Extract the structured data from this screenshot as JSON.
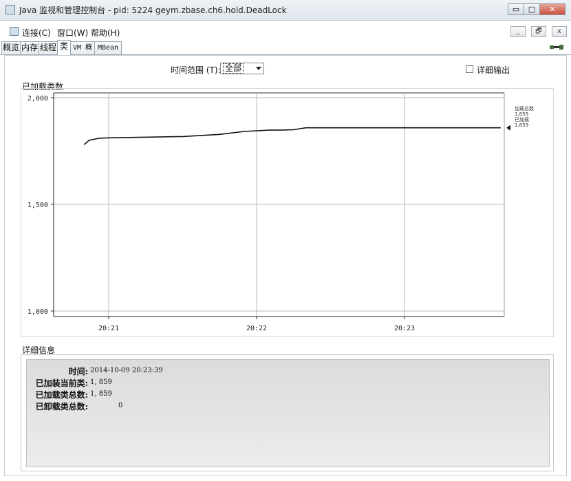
{
  "window": {
    "title": "Java 监视和管理控制台 - pid: 5224 geym.zbase.ch6.hold.DeadLock",
    "controls": {
      "minimize": "▭",
      "maximize": "□",
      "close": "✕"
    }
  },
  "menu": {
    "items": [
      "连接(C)",
      "窗口(W)",
      "帮助(H)"
    ],
    "inner_controls": [
      "_",
      "🗗",
      "x"
    ]
  },
  "tabs": [
    {
      "label": "概览",
      "active": false
    },
    {
      "label": "内存",
      "active": false
    },
    {
      "label": "线程",
      "active": false
    },
    {
      "label": "类",
      "active": true
    },
    {
      "label": "VM 概要",
      "active": false
    },
    {
      "label": "MBean",
      "active": false
    }
  ],
  "toolbar": {
    "range_label": "时间范围 (T):",
    "range_value": "全部",
    "detail_output_label": "详细输出"
  },
  "chart_section_label": "已加载类数",
  "chart_data": {
    "type": "line",
    "title": "已加载类数",
    "y_ticks": [
      "2,000",
      "1,500",
      "1,000"
    ],
    "x_ticks": [
      "20:21",
      "20:22",
      "20:23"
    ],
    "ylim": [
      1000,
      2000
    ],
    "grid": true,
    "legend": {
      "entries": [
        "加载总数",
        "1,859",
        "已加载",
        "1,859"
      ],
      "placement": "right"
    },
    "series": [
      {
        "name": "已加载",
        "x": [
          "20:20:50",
          "20:20:52",
          "20:20:56",
          "20:21:00",
          "20:21:10",
          "20:21:30",
          "20:21:45",
          "20:21:55",
          "20:22:05",
          "20:22:10",
          "20:22:15",
          "20:22:20",
          "20:22:40",
          "20:23:00",
          "20:23:20",
          "20:23:39"
        ],
        "values": [
          1780,
          1800,
          1810,
          1812,
          1814,
          1818,
          1828,
          1842,
          1848,
          1848,
          1850,
          1859,
          1859,
          1859,
          1859,
          1859
        ]
      }
    ]
  },
  "details": {
    "section_label": "详细信息",
    "rows": [
      {
        "label": "时间:",
        "value": "2014-10-09 20:23:39"
      },
      {
        "label": "已加装当前类:",
        "value": "1, 859"
      },
      {
        "label": "已加载类总数:",
        "value": "1, 859"
      },
      {
        "label": "已卸载类总数:",
        "value": "0"
      }
    ]
  }
}
